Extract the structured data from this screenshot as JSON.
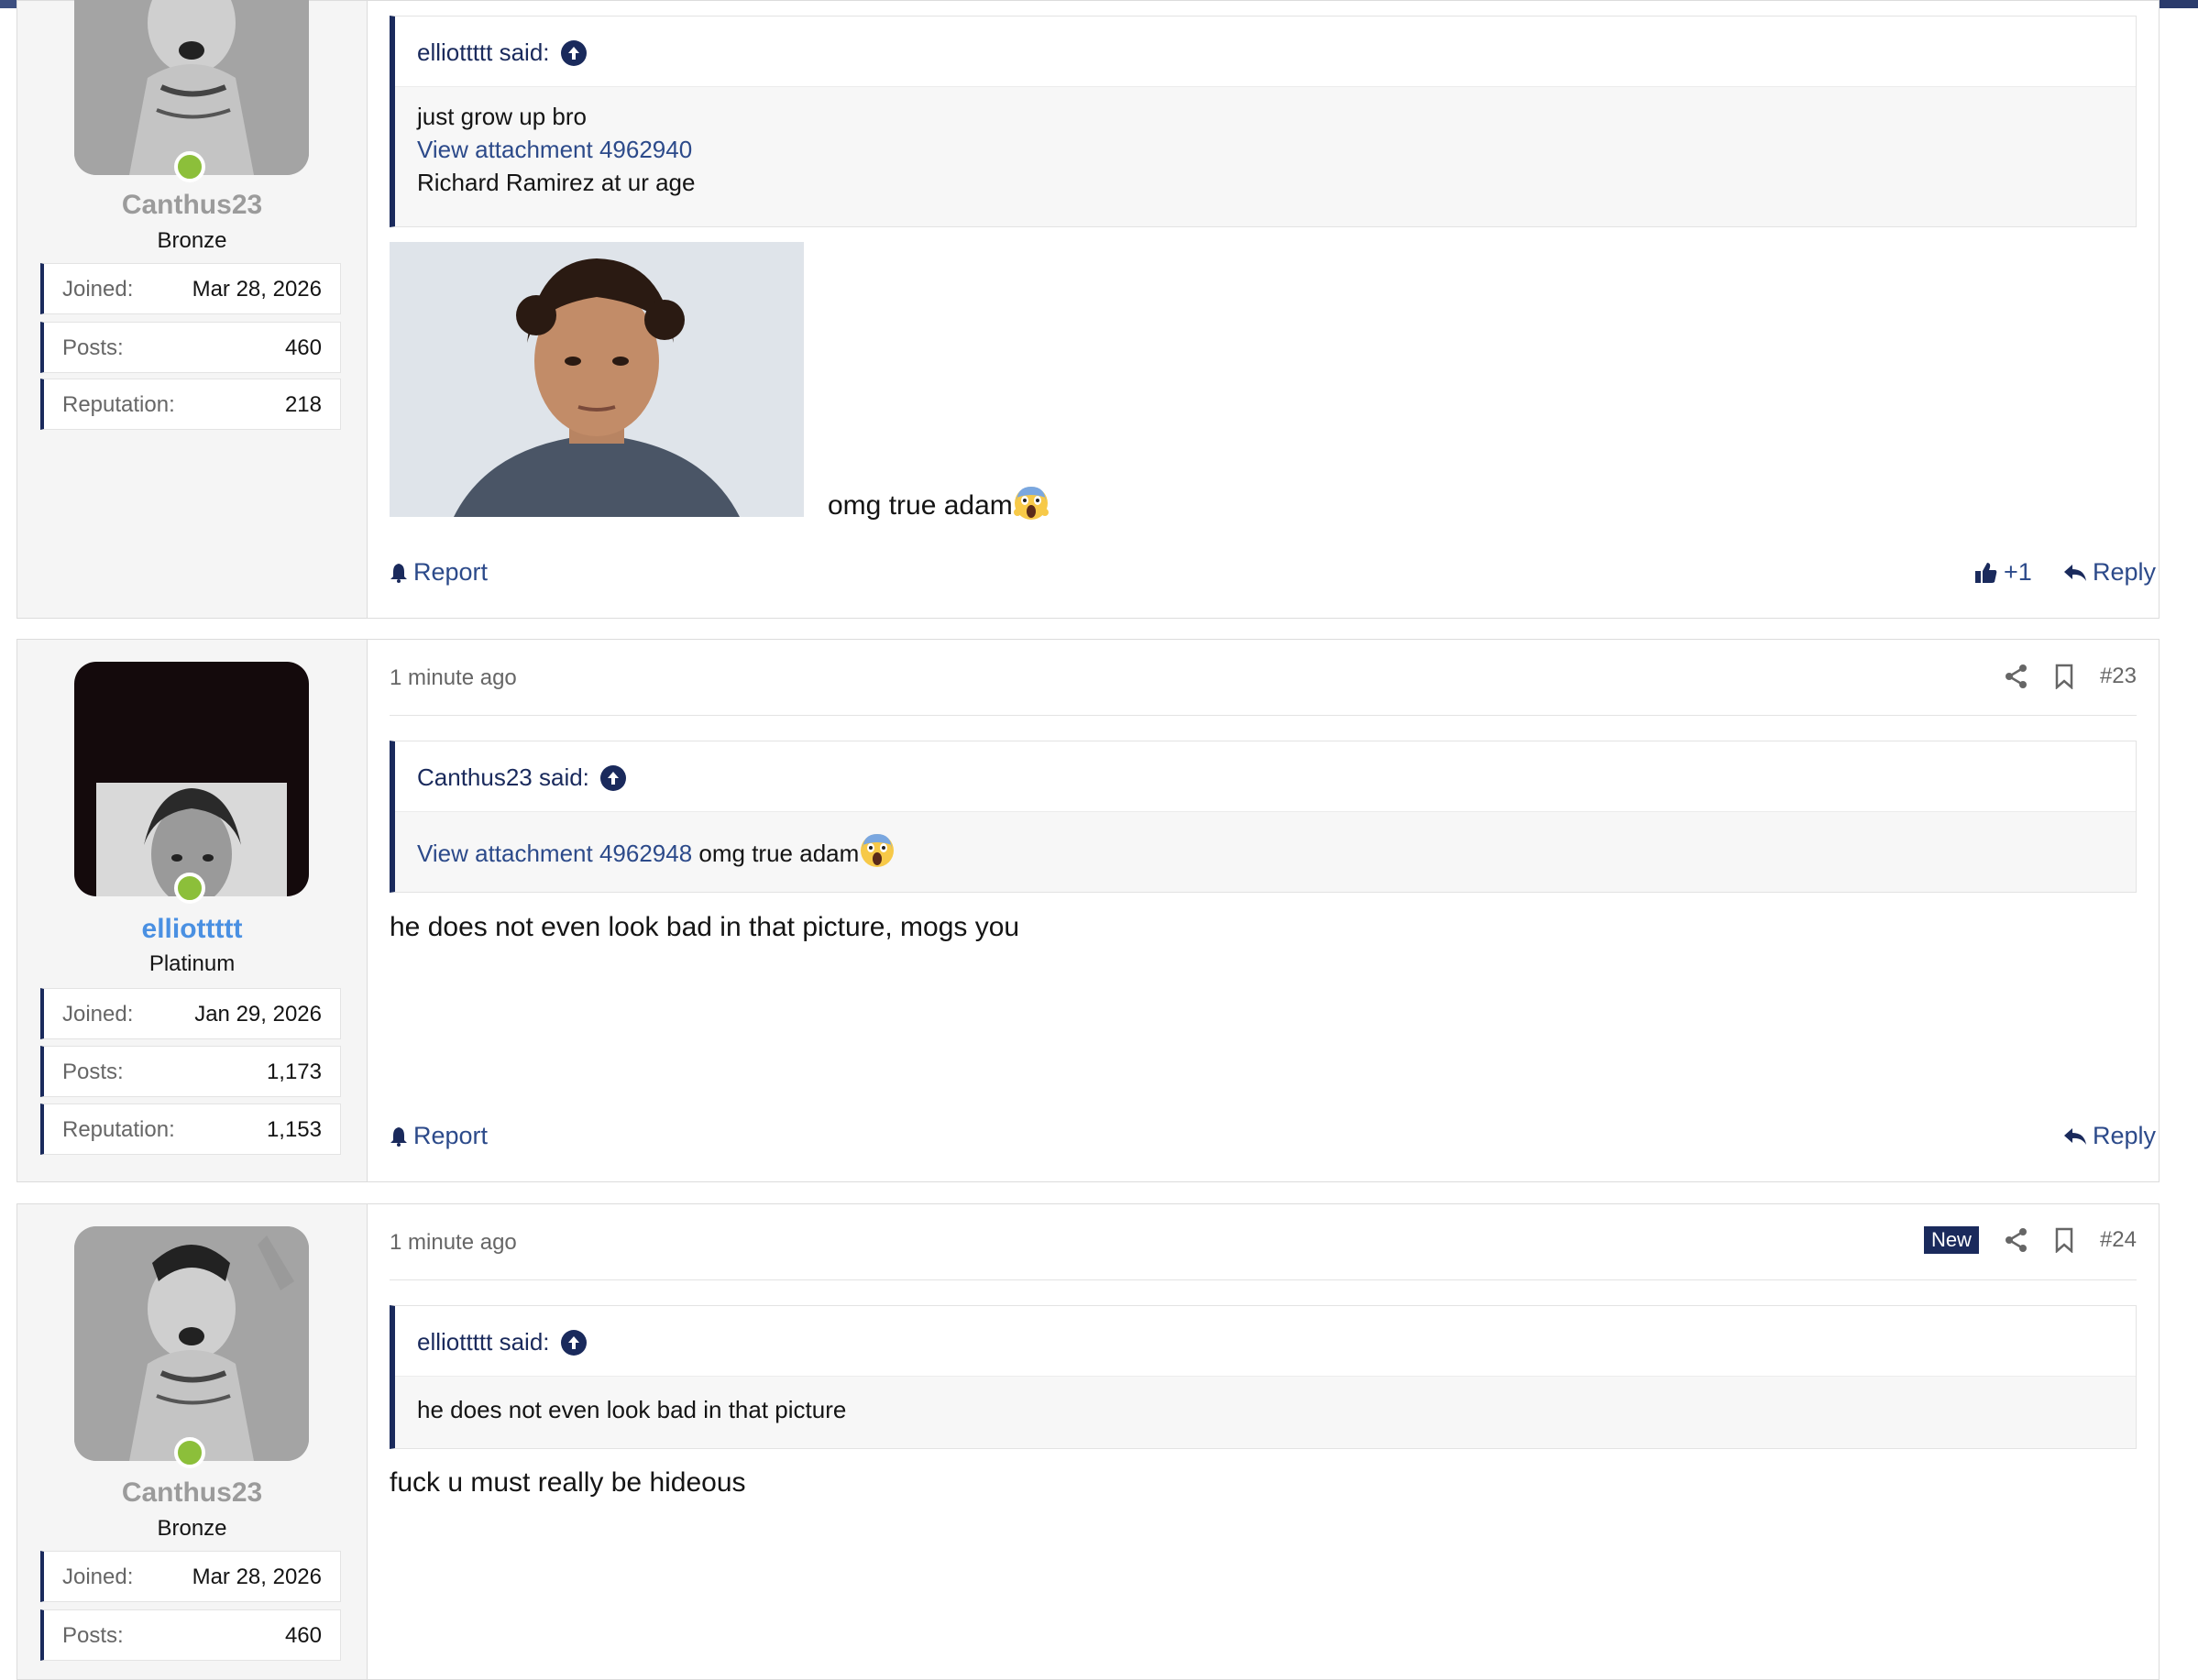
{
  "posts": [
    {
      "author": {
        "name": "Canthus23",
        "rank": "Bronze",
        "joined_label": "Joined:",
        "joined": "Mar 28, 2026",
        "posts_label": "Posts:",
        "posts": "460",
        "rep_label": "Reputation:",
        "rep": "218"
      },
      "quote": {
        "who": "elliottttt said:",
        "line1": "just grow up bro",
        "link": "View attachment 4962940",
        "line3": "Richard Ramirez at ur age"
      },
      "caption": "omg true adam",
      "report": "Report",
      "likes": "+1",
      "reply": "Reply"
    },
    {
      "time": "1 minute ago",
      "number": "#23",
      "author": {
        "name": "elliottttt",
        "rank": "Platinum",
        "joined_label": "Joined:",
        "joined": "Jan 29, 2026",
        "posts_label": "Posts:",
        "posts": "1,173",
        "rep_label": "Reputation:",
        "rep": "1,153"
      },
      "quote": {
        "who": "Canthus23 said:",
        "link": "View attachment 4962948",
        "after_link": " omg true adam"
      },
      "text": "he does not even look bad in that picture, mogs you",
      "report": "Report",
      "reply": "Reply"
    },
    {
      "time": "1 minute ago",
      "new_badge": "New",
      "number": "#24",
      "author": {
        "name": "Canthus23",
        "rank": "Bronze",
        "joined_label": "Joined:",
        "joined": "Mar 28, 2026",
        "posts_label": "Posts:",
        "posts": "460"
      },
      "quote": {
        "who": "elliottttt said:",
        "line1": "he does not even look bad in that picture"
      },
      "text": "fuck u must really be hideous"
    }
  ],
  "colors": {
    "accent": "#1a2a5c",
    "link": "#2c4a8a",
    "online": "#8cbf3a",
    "username_blue": "#4a90e2"
  }
}
